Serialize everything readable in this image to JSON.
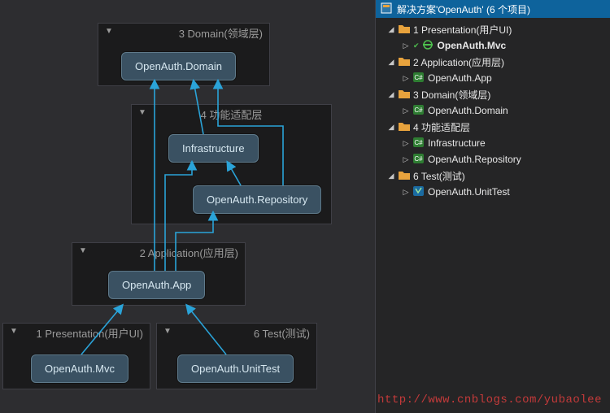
{
  "diagram": {
    "groups": {
      "domain": {
        "title": "3 Domain(领域层)"
      },
      "adapter": {
        "title": "4 功能适配层"
      },
      "app": {
        "title": "2 Application(应用层)"
      },
      "pres": {
        "title": "1 Presentation(用户UI)"
      },
      "test": {
        "title": "6 Test(测试)"
      }
    },
    "nodes": {
      "domain": "OpenAuth.Domain",
      "infra": "Infrastructure",
      "repository": "OpenAuth.Repository",
      "appnode": "OpenAuth.App",
      "mvc": "OpenAuth.Mvc",
      "unittest": "OpenAuth.UnitTest"
    }
  },
  "solution": {
    "header": "解决方案'OpenAuth' (6 个项目)",
    "items": {
      "presentation": {
        "label": "1 Presentation(用户UI)",
        "proj": "OpenAuth.Mvc"
      },
      "application": {
        "label": "2 Application(应用层)",
        "proj": "OpenAuth.App"
      },
      "domain": {
        "label": "3 Domain(领域层)",
        "proj": "OpenAuth.Domain"
      },
      "adapter": {
        "label": "4 功能适配层",
        "proj1": "Infrastructure",
        "proj2": "OpenAuth.Repository"
      },
      "test": {
        "label": "6 Test(测试)",
        "proj": "OpenAuth.UnitTest"
      }
    }
  },
  "watermark": "http://www.cnblogs.com/yubaolee"
}
